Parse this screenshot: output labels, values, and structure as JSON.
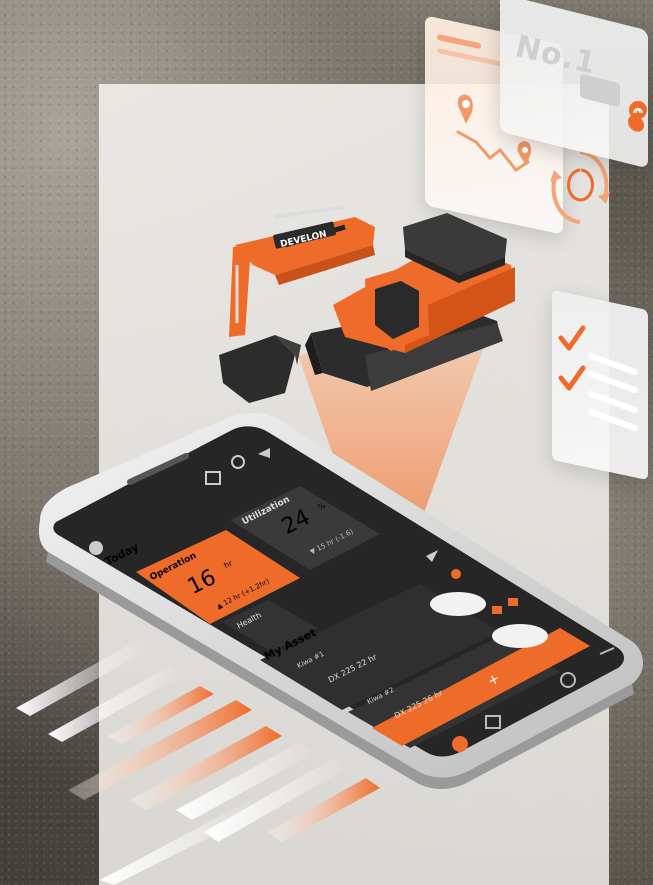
{
  "brand": {
    "excavator_label": "DEVELON"
  },
  "cards": {
    "rank_label": "No.1"
  },
  "app": {
    "header": {
      "greeting": "Today"
    },
    "operation": {
      "label": "Operation",
      "value": "16",
      "unit": "hr",
      "sub": "▲ 12 hr  (+1.2hr)"
    },
    "utilization": {
      "label": "Utilization",
      "value": "24",
      "unit": "%",
      "sub": "▼ 15 hr  (-1.6)"
    },
    "health": {
      "label": "Health"
    },
    "assets": {
      "title": "My Asset",
      "items": [
        {
          "name": "Kiwa #1",
          "meta": "DX 225  22 hr"
        },
        {
          "name": "Kiwa #2",
          "meta": "DX 225  26 hr"
        }
      ]
    },
    "add_symbol": "+"
  },
  "colors": {
    "accent": "#ef6b2a",
    "accent_dark": "#c9521a",
    "screen_bg": "#2a2a2a",
    "card_bg": "#3a3a3a"
  }
}
